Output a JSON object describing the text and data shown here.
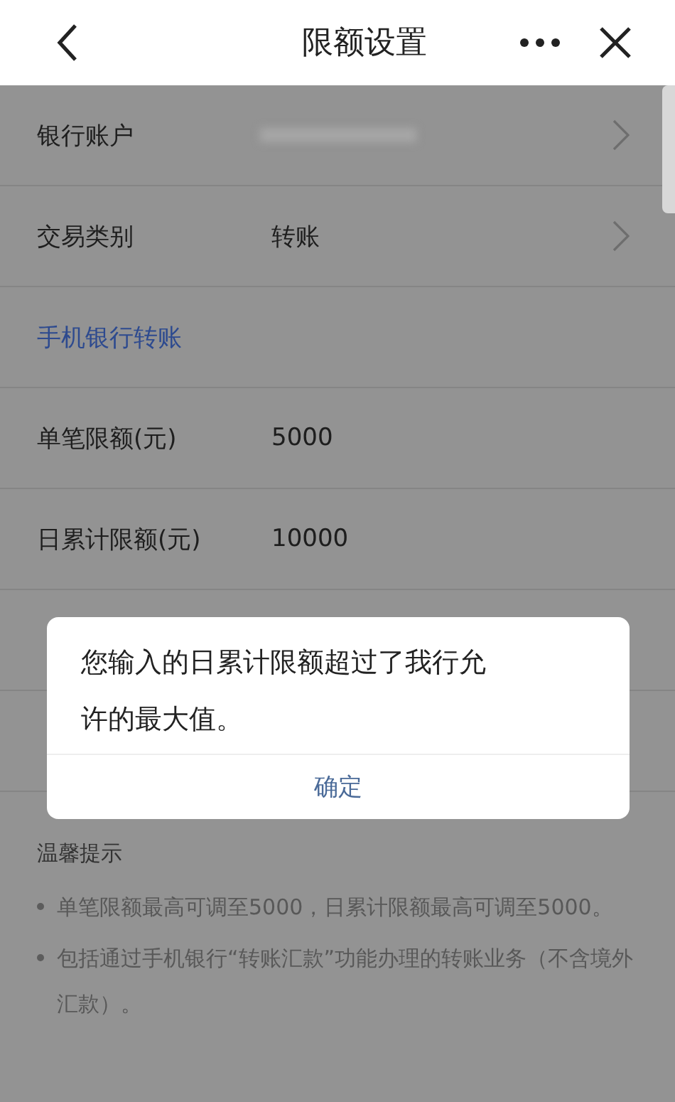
{
  "header": {
    "title": "限额设置"
  },
  "rows": [
    {
      "kind": "account",
      "label": "银行账户"
    },
    {
      "kind": "select",
      "label": "交易类别",
      "value": "转账"
    },
    {
      "kind": "section",
      "label": "手机银行转账"
    },
    {
      "kind": "input",
      "label": "单笔限额(元)",
      "value": "5000"
    },
    {
      "kind": "input",
      "label": "日累计限额(元)",
      "value": "10000"
    }
  ],
  "tips": {
    "title": "温馨提示",
    "items": [
      "单笔限额最高可调至5000，日累计限额最高可调至5000。",
      "包括通过手机银行“转账汇款”功能办理的转账业务（不含境外汇款）。"
    ]
  },
  "dialog": {
    "message": "您输入的日累计限额超过了我行允许的最大值。",
    "button": "确定"
  }
}
